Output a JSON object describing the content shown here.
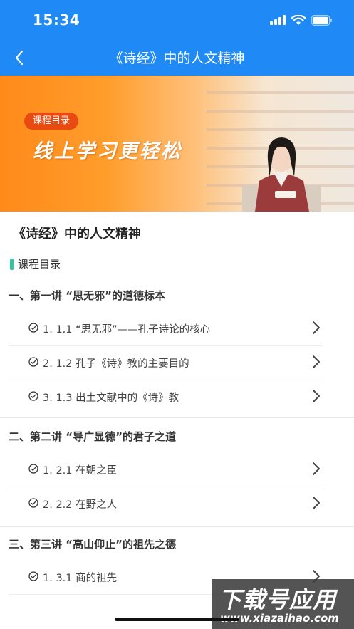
{
  "status_bar": {
    "time": "15:34"
  },
  "nav": {
    "title": "《诗经》中的人文精神"
  },
  "banner": {
    "tag": "课程目录",
    "slogan": "线上学习更轻松"
  },
  "course": {
    "title": "《诗经》中的人文精神",
    "section_heading": "课程目录"
  },
  "chapters": [
    {
      "title": "一、第一讲 “思无邪”的道德标本",
      "lessons": [
        "1. 1.1 “思无邪”——孔子诗论的核心",
        "2. 1.2 孔子《诗》教的主要目的",
        "3. 1.3 出土文献中的《诗》教"
      ]
    },
    {
      "title": "二、第二讲 “导广显德”的君子之道",
      "lessons": [
        "1. 2.1 在朝之臣",
        "2. 2.2 在野之人"
      ]
    },
    {
      "title": "三、第三讲 “高山仰止”的祖先之德",
      "lessons": [
        "1. 3.1 商的祖先"
      ]
    }
  ],
  "watermark": {
    "name": "下载号应用",
    "url": "www.xiazaihao.com"
  },
  "colors": {
    "header": "#1f8af5",
    "accent_marker": "#2dc7a0",
    "banner_tag": "#e84a12"
  }
}
